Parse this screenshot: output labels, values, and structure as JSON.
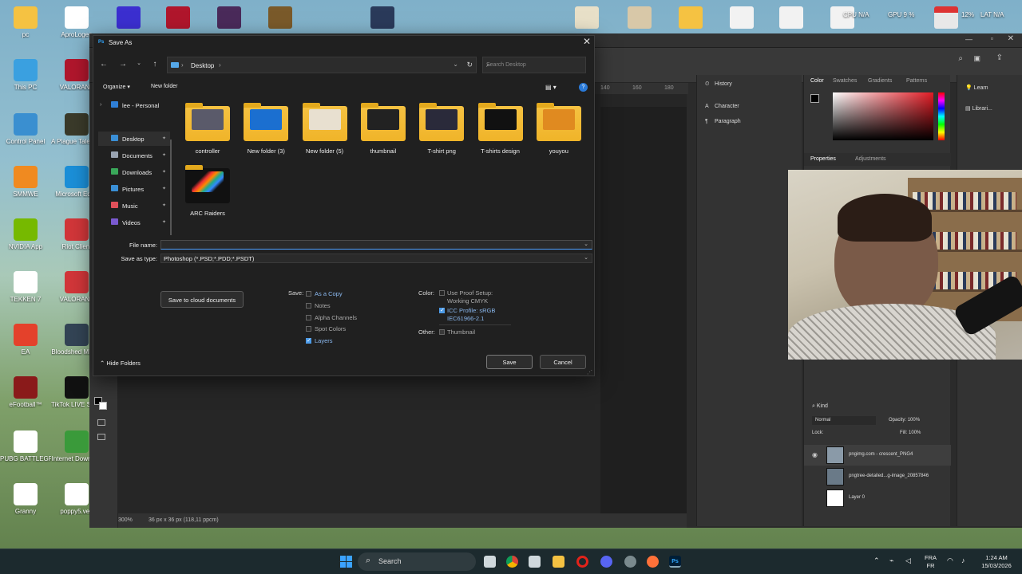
{
  "desktop": {
    "icons": [
      {
        "label": "pc",
        "color": "#f5c242"
      },
      {
        "label": "AproLogen",
        "color": "#ffffff"
      },
      {
        "label": "This PC",
        "color": "#3aa0e0"
      },
      {
        "label": "VALORANT",
        "color": "#b0162c"
      },
      {
        "label": "Control Panel",
        "color": "#3a8fd0"
      },
      {
        "label": "A Plague Tale Requiem",
        "color": "#3a3a2a"
      },
      {
        "label": "SMMWE",
        "color": "#f08a20"
      },
      {
        "label": "Microsoft Edge",
        "color": "#1b8fd8"
      },
      {
        "label": "NVIDIA App",
        "color": "#76b900"
      },
      {
        "label": "Riot Client",
        "color": "#d13639"
      },
      {
        "label": "TEKKEN 7",
        "color": "#ffffff"
      },
      {
        "label": "VALORANT",
        "color": "#d13639"
      },
      {
        "label": "EA",
        "color": "#e4412b"
      },
      {
        "label": "Bloodshed MENA",
        "color": "#334455"
      },
      {
        "label": "eFootball™",
        "color": "#8a1a1a"
      },
      {
        "label": "TikTok LIVE Studio",
        "color": "#111111"
      },
      {
        "label": "PUBG BATTLEGROU...",
        "color": "#ffffff"
      },
      {
        "label": "Internet Downlo...",
        "color": "#3a9a3a"
      },
      {
        "label": "Granny",
        "color": "#ffffff"
      },
      {
        "label": "poppy5.veg",
        "color": "#ffffff"
      }
    ]
  },
  "photoshop": {
    "ruler_ticks": [
      "140",
      "160",
      "180"
    ],
    "status_zoom": "300%",
    "status_info": "36 px x 36 px (118,11 ppcm)",
    "history_label": "History",
    "character_label": "Character",
    "paragraph_label": "Paragraph",
    "color_tabs": [
      "Color",
      "Swatches",
      "Gradients",
      "Patterns"
    ],
    "learn_label": "Learn",
    "libraries_label": "Librari...",
    "properties_tabs": [
      "Properties",
      "Adjustments"
    ],
    "layers_kind": "Kind",
    "blend_mode": "Normal",
    "opacity_label": "Opacity:",
    "opacity_value": "100%",
    "lock_label": "Lock:",
    "fill_label": "Fill:",
    "fill_value": "100%",
    "layers": [
      {
        "name": "pngimg.com - crescent_PNG4"
      },
      {
        "name": "pngtree-detailed...g-image_20857846"
      },
      {
        "name": "Layer 0"
      }
    ]
  },
  "dialog": {
    "title": "Save As",
    "app_badge": "Ps",
    "address_crumb": "Desktop",
    "search_placeholder": "Search Desktop",
    "organize_label": "Organize",
    "new_folder_label": "New folder",
    "nav_items": [
      {
        "label": "lee - Personal",
        "color": "#2f7fd6"
      },
      {
        "label": "Desktop",
        "color": "#3a8fd6"
      },
      {
        "label": "Documents",
        "color": "#9aa4b2"
      },
      {
        "label": "Downloads",
        "color": "#3aa85a"
      },
      {
        "label": "Pictures",
        "color": "#3a8fd6"
      },
      {
        "label": "Music",
        "color": "#e0505a"
      },
      {
        "label": "Videos",
        "color": "#7a5ad0"
      }
    ],
    "files": [
      {
        "label": "controller"
      },
      {
        "label": "New folder (3)"
      },
      {
        "label": "New folder (5)"
      },
      {
        "label": "thumbnail"
      },
      {
        "label": "T-shirt png"
      },
      {
        "label": "T-shirts design"
      },
      {
        "label": "youyou"
      },
      {
        "label": "ARC Raiders"
      }
    ],
    "file_name_label": "File name:",
    "file_name_value": "",
    "save_as_type_label": "Save as type:",
    "save_as_type_value": "Photoshop (*.PSD;*.PDD;*.PSDT)",
    "cloud_button": "Save to cloud documents",
    "save_label": "Save:",
    "save_options": [
      {
        "label": "As a Copy",
        "checked": false
      },
      {
        "label": "Notes",
        "checked": false
      },
      {
        "label": "Alpha Channels",
        "checked": false
      },
      {
        "label": "Spot Colors",
        "checked": false
      },
      {
        "label": "Layers",
        "checked": true
      }
    ],
    "color_label": "Color:",
    "proof_setup": "Use Proof Setup:",
    "proof_value": "Working CMYK",
    "icc_profile": "ICC Profile: sRGB",
    "icc_value": "IEC61966-2.1",
    "other_label": "Other:",
    "thumbnail_label": "Thumbnail",
    "hide_folders": "Hide Folders",
    "save_button": "Save",
    "cancel_button": "Cancel"
  },
  "topbar": {
    "cpu_label": "CPU N/A",
    "gpu_label": "GPU 9 %",
    "net_label": "12%",
    "lat_label": "LAT N/A"
  },
  "taskbar": {
    "search_label": "Search",
    "language": "FRA",
    "language_sub": "FR",
    "time": "1:24 AM",
    "date": "15/03/2026"
  }
}
